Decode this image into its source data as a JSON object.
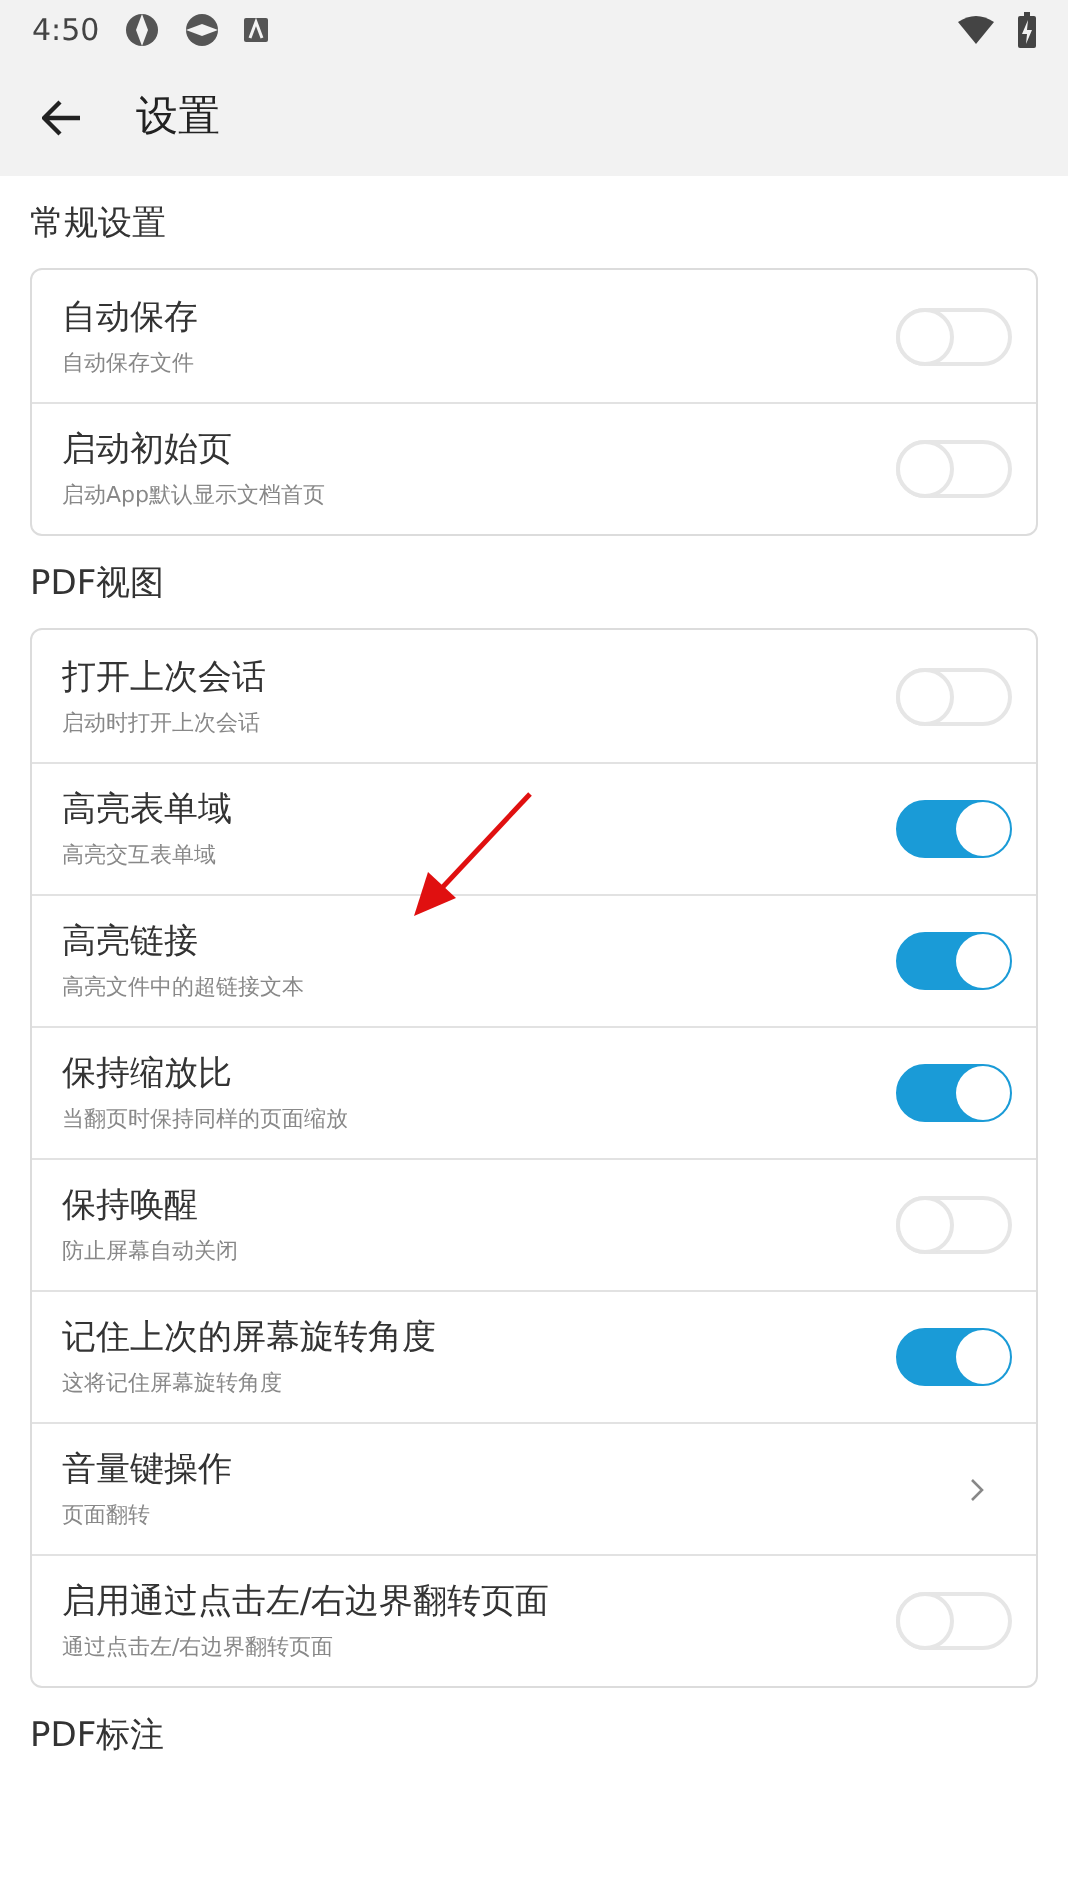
{
  "status_bar": {
    "time": "4:50"
  },
  "app_bar": {
    "title": "设置"
  },
  "sections": [
    {
      "title": "常规设置",
      "items": [
        {
          "kind": "toggle",
          "title": "自动保存",
          "subtitle": "自动保存文件",
          "on": false
        },
        {
          "kind": "toggle",
          "title": "启动初始页",
          "subtitle": "启动App默认显示文档首页",
          "on": false
        }
      ]
    },
    {
      "title": "PDF视图",
      "items": [
        {
          "kind": "toggle",
          "title": "打开上次会话",
          "subtitle": "启动时打开上次会话",
          "on": false
        },
        {
          "kind": "toggle",
          "title": "高亮表单域",
          "subtitle": "高亮交互表单域",
          "on": true
        },
        {
          "kind": "toggle",
          "title": "高亮链接",
          "subtitle": "高亮文件中的超链接文本",
          "on": true
        },
        {
          "kind": "toggle",
          "title": "保持缩放比",
          "subtitle": "当翻页时保持同样的页面缩放",
          "on": true
        },
        {
          "kind": "toggle",
          "title": "保持唤醒",
          "subtitle": "防止屏幕自动关闭",
          "on": false
        },
        {
          "kind": "toggle",
          "title": "记住上次的屏幕旋转角度",
          "subtitle": "这将记住屏幕旋转角度",
          "on": true
        },
        {
          "kind": "link",
          "title": "音量键操作",
          "subtitle": "页面翻转"
        },
        {
          "kind": "toggle",
          "title": "启用通过点击左/右边界翻转页面",
          "subtitle": "通过点击左/右边界翻转页面",
          "on": false
        }
      ]
    },
    {
      "title": "PDF标注"
    }
  ]
}
